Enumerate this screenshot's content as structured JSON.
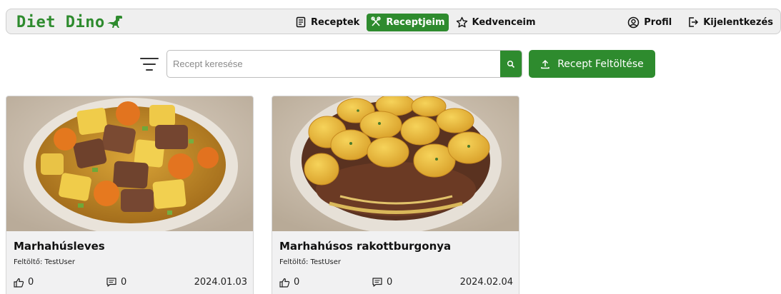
{
  "header": {
    "brand": "Diet Dino",
    "nav": [
      {
        "label": "Receptek",
        "icon": "recipe-book-icon",
        "active": false
      },
      {
        "label": "Receptjeim",
        "icon": "utensils-icon",
        "active": true
      },
      {
        "label": "Kedvenceim",
        "icon": "star-icon",
        "active": false
      }
    ],
    "profile_label": "Profil",
    "logout_label": "Kijelentkezés"
  },
  "search": {
    "placeholder": "Recept keresése",
    "value": "",
    "filter_icon": "filter-icon",
    "search_icon": "search-icon"
  },
  "upload_button": {
    "label": "Recept Feltöltése",
    "icon": "upload-icon"
  },
  "colors": {
    "accent": "#2e8b2e",
    "card_bg": "#f1f1f2"
  },
  "recipes": [
    {
      "title": "Marhahúsleves",
      "uploader": "Feltöltő: TestUser",
      "likes": "0",
      "comments": "0",
      "date": "2024.01.03",
      "image": "beef-soup-photo"
    },
    {
      "title": "Marhahúsos rakottburgonya",
      "uploader": "Feltöltő: TestUser",
      "likes": "0",
      "comments": "0",
      "date": "2024.02.04",
      "image": "layered-potato-casserole-photo"
    }
  ]
}
